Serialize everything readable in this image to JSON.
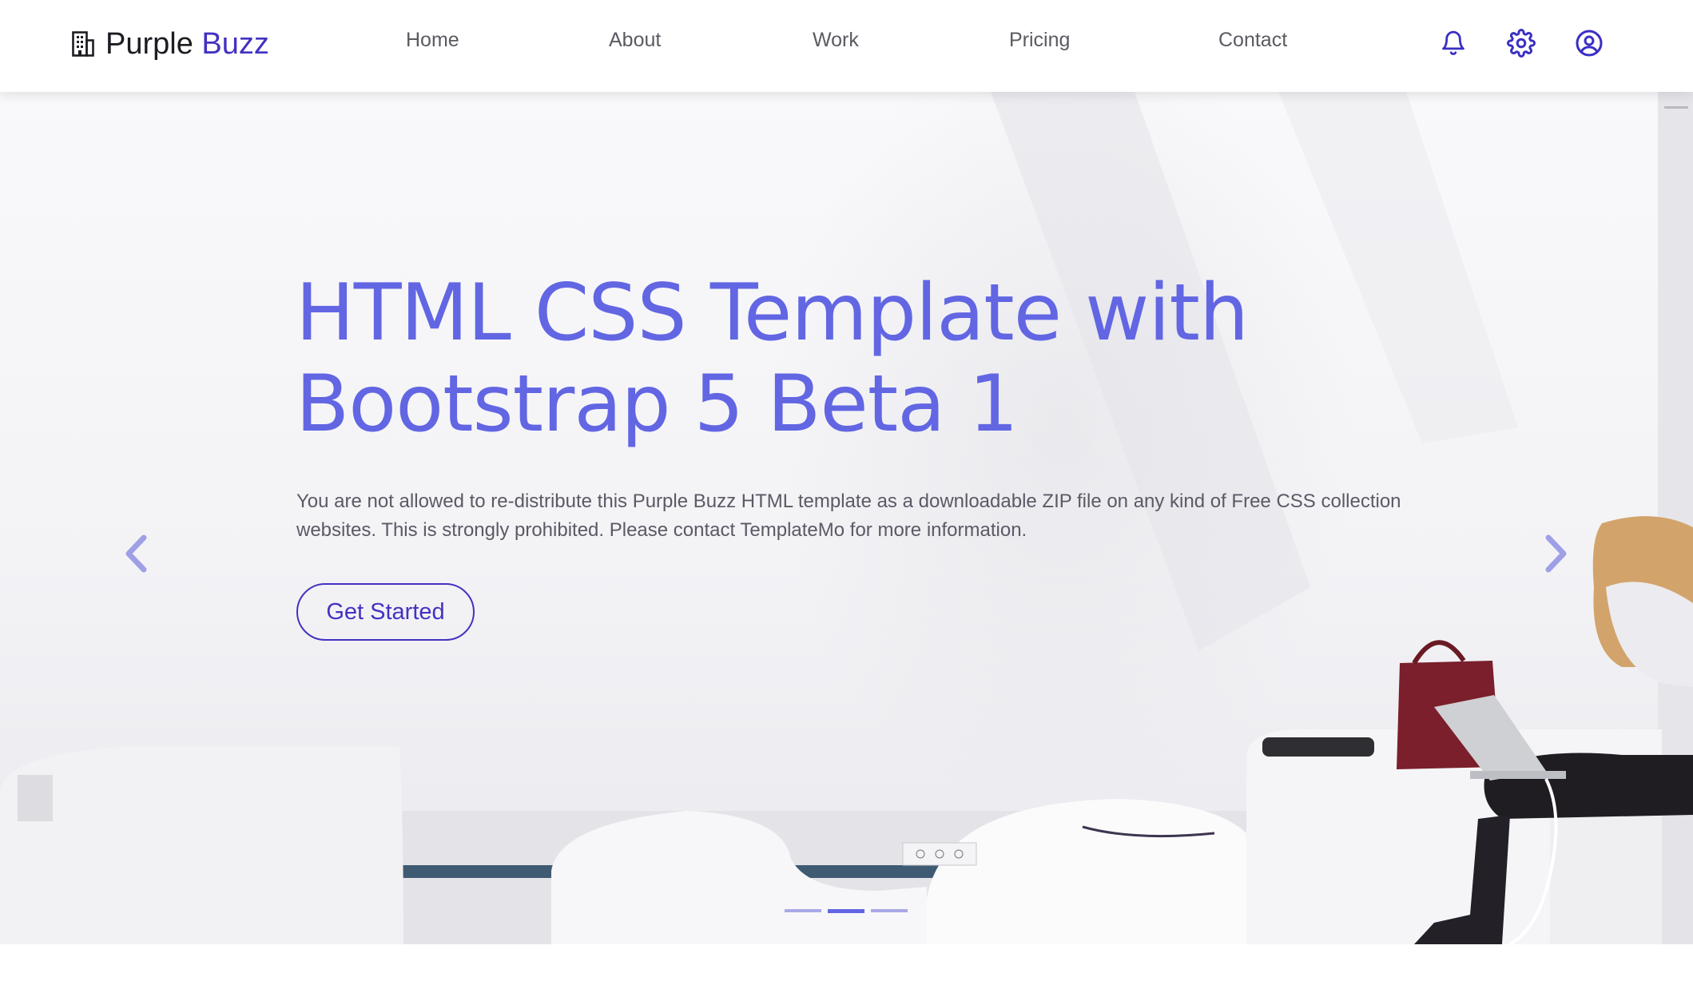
{
  "brand": {
    "icon": "building-icon",
    "name_part1": "Purple",
    "name_part2": "Buzz",
    "accent_color": "#4232c2"
  },
  "nav": {
    "links": [
      {
        "label": "Home"
      },
      {
        "label": "About"
      },
      {
        "label": "Work"
      },
      {
        "label": "Pricing"
      },
      {
        "label": "Contact"
      }
    ],
    "icons": [
      "bell-icon",
      "gear-icon",
      "user-circle-icon"
    ]
  },
  "hero": {
    "title_line1": "HTML CSS Template with",
    "title_line2": "Bootstrap 5 Beta 1",
    "description": "You are not allowed to re-distribute this Purple Buzz HTML template as a downloadable ZIP file on any kind of Free CSS collection websites. This is strongly prohibited. Please contact TemplateMo for more information.",
    "cta_label": "Get Started",
    "title_color": "#6266e3",
    "prev_icon": "chevron-left-icon",
    "next_icon": "chevron-right-icon",
    "slides_count": 3,
    "active_slide": 2
  }
}
